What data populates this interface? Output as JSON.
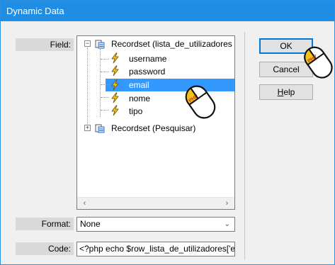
{
  "window": {
    "title": "Dynamic Data"
  },
  "labels": {
    "field": "Field:",
    "format": "Format:",
    "code": "Code:"
  },
  "tree": {
    "recordsets": [
      {
        "label": "Recordset (lista_de_utilizadores",
        "expanded": true,
        "expander": "−",
        "fields": [
          "username",
          "password",
          "email",
          "nome",
          "tipo"
        ],
        "selected_field": "email"
      },
      {
        "label": "Recordset (Pesquisar)",
        "expanded": false,
        "expander": "+"
      }
    ],
    "scroll_left": "‹",
    "scroll_right": "›"
  },
  "format": {
    "selected": "None"
  },
  "code": {
    "value": "<?php echo $row_lista_de_utilizadores['e"
  },
  "buttons": {
    "ok": "OK",
    "cancel": "Cancel",
    "help_prefix": "",
    "help_mnemonic": "H",
    "help_rest": "elp"
  },
  "mouse_badge": "PHP",
  "colors": {
    "titlebar": "#1e8de3",
    "selection": "#3399ff",
    "default_button_border": "#0078d7",
    "mouse_badge": "#f2c21b"
  }
}
